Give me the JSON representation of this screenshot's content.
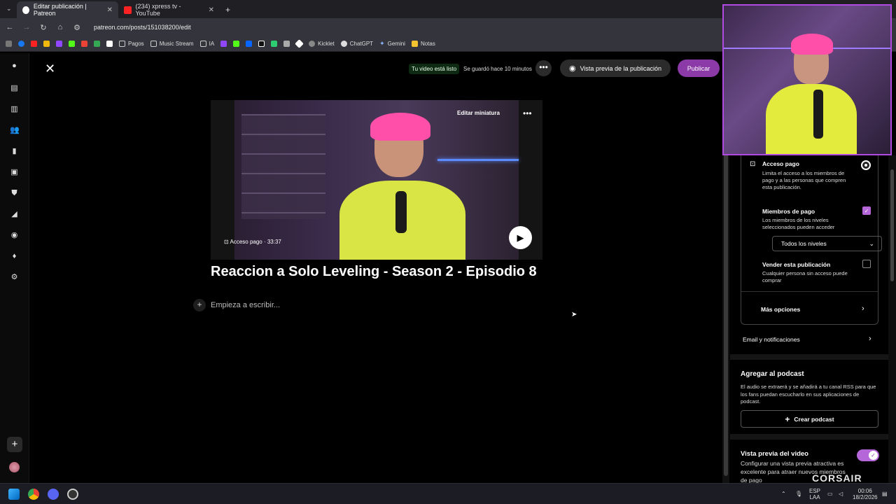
{
  "browser": {
    "tabs": [
      {
        "label": "Editar publicación | Patreon",
        "active": true
      },
      {
        "label": "(234) xpress tv - YouTube",
        "active": false
      }
    ],
    "new_tab": "+",
    "url": "patreon.com/posts/151038200/edit",
    "bookmarks": [
      "Pagos",
      "Music Stream",
      "IA",
      "Kicklet",
      "ChatGPT",
      "Gemini",
      "Notas"
    ]
  },
  "topbar": {
    "video_ready": "Tu video está listo",
    "saved": "Se guardó hace 10 minutos",
    "preview_label": "Vista previa de la publicación",
    "publish_label": "Publicar"
  },
  "video": {
    "edit_thumbnail": "Editar miniatura",
    "access_badge": "Acceso pago · 33:37"
  },
  "post": {
    "title": "Reaccion a Solo Leveling - Season 2 - Episodio 8",
    "body_placeholder": "Empieza a escribir..."
  },
  "settings": {
    "paid_access": {
      "title": "Acceso pago",
      "desc": "Limita el acceso a los miembros de pago y a las personas que compren esta publicación."
    },
    "paid_members": {
      "title": "Miembros de pago",
      "desc": "Los miembros de los niveles seleccionados pueden acceder",
      "select_value": "Todos los niveles"
    },
    "sell_post": {
      "title": "Vender esta publicación",
      "desc": "Cualquier persona sin acceso puede comprar"
    },
    "more_options": "Más opciones",
    "email_notifications": "Email y notificaciones",
    "podcast": {
      "title": "Agregar al podcast",
      "desc": "El audio se extraerá y se añadirá a tu canal RSS para que los fans puedan escucharlo en sus aplicaciones de podcast.",
      "button": "Crear podcast"
    },
    "video_preview": {
      "title": "Vista previa del video",
      "desc": "Configurar una vista previa atractiva es excelente para atraer nuevos miembros de pago"
    }
  },
  "overlay": {
    "brand": "CORSAIR"
  },
  "taskbar": {
    "lang_top": "ESP",
    "lang_bottom": "LAA",
    "time": "00:06",
    "date": "18/2/2026"
  }
}
